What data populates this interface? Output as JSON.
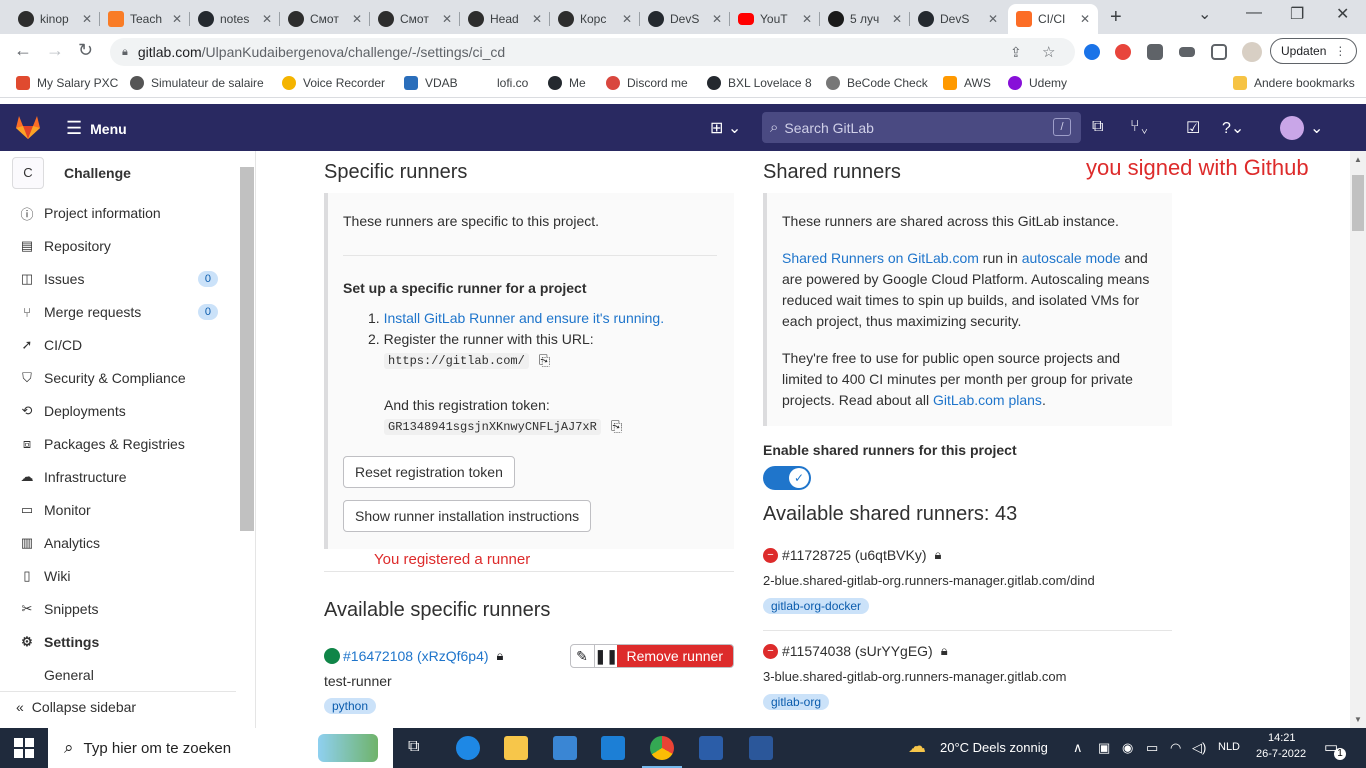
{
  "browser": {
    "tabs": [
      {
        "title": "kinop",
        "favicon": "#2d2d2d"
      },
      {
        "title": "Teach",
        "favicon": "#f97c26"
      },
      {
        "title": "notes",
        "favicon": "#24292f"
      },
      {
        "title": "Смот",
        "favicon": "#2d2d2d"
      },
      {
        "title": "Смот",
        "favicon": "#2d2d2d"
      },
      {
        "title": "Head",
        "favicon": "#2d2d2d"
      },
      {
        "title": "Корс",
        "favicon": "#2d2d2d"
      },
      {
        "title": "DevS",
        "favicon": "#24292f"
      },
      {
        "title": "YouT",
        "favicon": "#ff0000"
      },
      {
        "title": "5 луч",
        "favicon": "#1a1a1a"
      },
      {
        "title": "DevS",
        "favicon": "#24292f"
      },
      {
        "title": "CI/CI",
        "favicon": "#fc6d26",
        "active": true
      }
    ],
    "url_host": "gitlab.com",
    "url_path": "/UlpanKudaibergenova/challenge/-/settings/ci_cd",
    "update_label": "Updaten",
    "bookmarks": [
      {
        "label": "My Salary PXC",
        "color": "#e04a2f"
      },
      {
        "label": "Simulateur de salaire",
        "color": "#555555"
      },
      {
        "label": "Voice Recorder",
        "color": "#f4b400"
      },
      {
        "label": "VDAB",
        "color": "#2a6ebb"
      },
      {
        "label": "lofi.co",
        "color": "#ffffff"
      },
      {
        "label": "Me",
        "color": "#24292f"
      },
      {
        "label": "Discord me",
        "color": "#d9473e"
      },
      {
        "label": "BXL Lovelace 8",
        "color": "#24292f"
      },
      {
        "label": "BeCode Check",
        "color": "#777777"
      },
      {
        "label": "AWS",
        "color": "#ff9900"
      },
      {
        "label": "Udemy",
        "color": "#8710d8"
      }
    ],
    "other_bookmarks": "Andere bookmarks"
  },
  "gitlab": {
    "menu_label": "Menu",
    "search_placeholder": "Search GitLab",
    "search_shortcut": "/"
  },
  "sidebar": {
    "project_initial": "C",
    "project_name": "Challenge",
    "items": [
      {
        "label": "Project information",
        "icon": "info-icon",
        "glyph": "ⓘ"
      },
      {
        "label": "Repository",
        "icon": "doc-icon",
        "glyph": "▤"
      },
      {
        "label": "Issues",
        "icon": "issues-icon",
        "glyph": "◫",
        "count": "0"
      },
      {
        "label": "Merge requests",
        "icon": "merge-icon",
        "glyph": "⑂",
        "count": "0"
      },
      {
        "label": "CI/CD",
        "icon": "rocket-icon",
        "glyph": "➚"
      },
      {
        "label": "Security & Compliance",
        "icon": "shield-icon",
        "glyph": "⛉"
      },
      {
        "label": "Deployments",
        "icon": "deploy-icon",
        "glyph": "⟲"
      },
      {
        "label": "Packages & Registries",
        "icon": "package-icon",
        "glyph": "⧈"
      },
      {
        "label": "Infrastructure",
        "icon": "cloud-icon",
        "glyph": "☁"
      },
      {
        "label": "Monitor",
        "icon": "monitor-icon",
        "glyph": "▭"
      },
      {
        "label": "Analytics",
        "icon": "chart-icon",
        "glyph": "▥"
      },
      {
        "label": "Wiki",
        "icon": "book-icon",
        "glyph": "▯"
      },
      {
        "label": "Snippets",
        "icon": "scissors-icon",
        "glyph": "✂"
      },
      {
        "label": "Settings",
        "icon": "gear-icon",
        "glyph": "⚙",
        "bold": true
      }
    ],
    "sub_item": "General",
    "collapse_label": "Collapse sidebar"
  },
  "specific": {
    "heading": "Specific runners",
    "intro": "These runners are specific to this project.",
    "setup_heading": "Set up a specific runner for a project",
    "step1_num": "1.",
    "step1_link": "Install GitLab Runner and ensure it's running.",
    "step2_num": "2.",
    "step2_text": "Register the runner with this URL:",
    "url": "https://gitlab.com/",
    "token_label": "And this registration token:",
    "token": "GR1348941sgsjnXKnwyCNFLjAJ7xR",
    "reset_btn": "Reset registration token",
    "show_btn": "Show runner installation instructions",
    "available_heading": "Available specific runners",
    "runner_id": "#16472108 (xRzQf6p4)",
    "runner_name": "test-runner",
    "runner_tag": "python",
    "remove_btn": "Remove runner"
  },
  "shared": {
    "heading": "Shared runners",
    "intro": "These runners are shared across this GitLab instance.",
    "p1_link1": "Shared Runners on GitLab.com",
    "p1_mid": " run in ",
    "p1_link2": "autoscale mode",
    "p1_rest": " and are powered by Google Cloud Platform. Autoscaling means reduced wait times to spin up builds, and isolated VMs for each project, thus maximizing security.",
    "p2_text": "They're free to use for public open source projects and limited to 400 CI minutes per month per group for private projects. Read about all ",
    "p2_link": "GitLab.com plans",
    "p2_end": ".",
    "enable_label": "Enable shared runners for this project",
    "available_heading": "Available shared runners: 43",
    "runners": [
      {
        "id": "#11728725 (u6qtBVKy)",
        "host": "2-blue.shared-gitlab-org.runners-manager.gitlab.com/dind",
        "tag": "gitlab-org-docker"
      },
      {
        "id": "#11574038 (sUrYYgEG)",
        "host": "3-blue.shared-gitlab-org.runners-manager.gitlab.com",
        "tag": "gitlab-org"
      }
    ]
  },
  "annotations": {
    "github_note": "you signed with Github",
    "runner_note": "You registered a runner"
  },
  "taskbar": {
    "search_placeholder": "Typ hier om te zoeken",
    "weather": "20°C  Deels zonnig",
    "lang": "NLD",
    "time": "14:21",
    "date": "26-7-2022",
    "notif_count": "1"
  },
  "colors": {
    "gitlab_nav": "#292961",
    "link": "#1f75cb",
    "danger": "#dd2b2b",
    "success": "#108548"
  }
}
